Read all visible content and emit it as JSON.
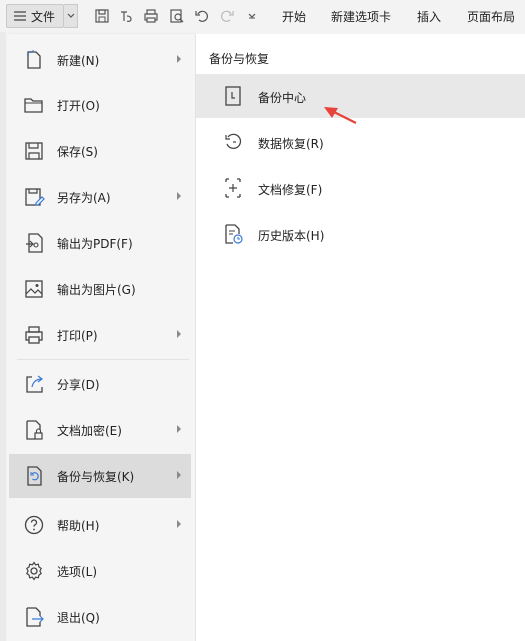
{
  "toolbar": {
    "file_label": "文件",
    "tabs": [
      "开始",
      "新建选项卡",
      "插入",
      "页面布局"
    ],
    "icons": [
      "save-icon",
      "save-to-cloud-icon",
      "print-icon",
      "print-preview-icon",
      "undo-icon",
      "redo-icon",
      "quick-access-dropdown-icon"
    ]
  },
  "menu": {
    "items": [
      {
        "label": "新建(N)",
        "icon": "new-document-icon",
        "submenu": true
      },
      {
        "label": "打开(O)",
        "icon": "folder-open-icon",
        "submenu": false
      },
      {
        "label": "保存(S)",
        "icon": "save-icon",
        "submenu": false
      },
      {
        "label": "另存为(A)",
        "icon": "save-as-icon",
        "submenu": true
      },
      {
        "label": "输出为PDF(F)",
        "icon": "export-pdf-icon",
        "submenu": false
      },
      {
        "label": "输出为图片(G)",
        "icon": "export-image-icon",
        "submenu": false
      },
      {
        "label": "打印(P)",
        "icon": "print-icon",
        "submenu": true
      },
      {
        "label": "分享(D)",
        "icon": "share-icon",
        "submenu": false
      },
      {
        "label": "文档加密(E)",
        "icon": "encrypt-icon",
        "submenu": true
      },
      {
        "label": "备份与恢复(K)",
        "icon": "backup-restore-icon",
        "submenu": true,
        "active": true
      },
      {
        "label": "帮助(H)",
        "icon": "help-icon",
        "submenu": true
      },
      {
        "label": "选项(L)",
        "icon": "gear-icon",
        "submenu": false
      },
      {
        "label": "退出(Q)",
        "icon": "exit-icon",
        "submenu": false
      }
    ]
  },
  "submenu": {
    "title": "备份与恢复",
    "items": [
      {
        "label": "备份中心",
        "icon": "backup-center-icon",
        "active": true
      },
      {
        "label": "数据恢复(R)",
        "icon": "data-recovery-icon"
      },
      {
        "label": "文档修复(F)",
        "icon": "document-repair-icon"
      },
      {
        "label": "历史版本(H)",
        "icon": "history-version-icon"
      }
    ]
  },
  "colors": {
    "menu_bg": "#f5f5f5",
    "active_bg": "#dcdcdc",
    "submenu_bg": "#ffffff",
    "annotation_arrow": "#e8433a"
  }
}
